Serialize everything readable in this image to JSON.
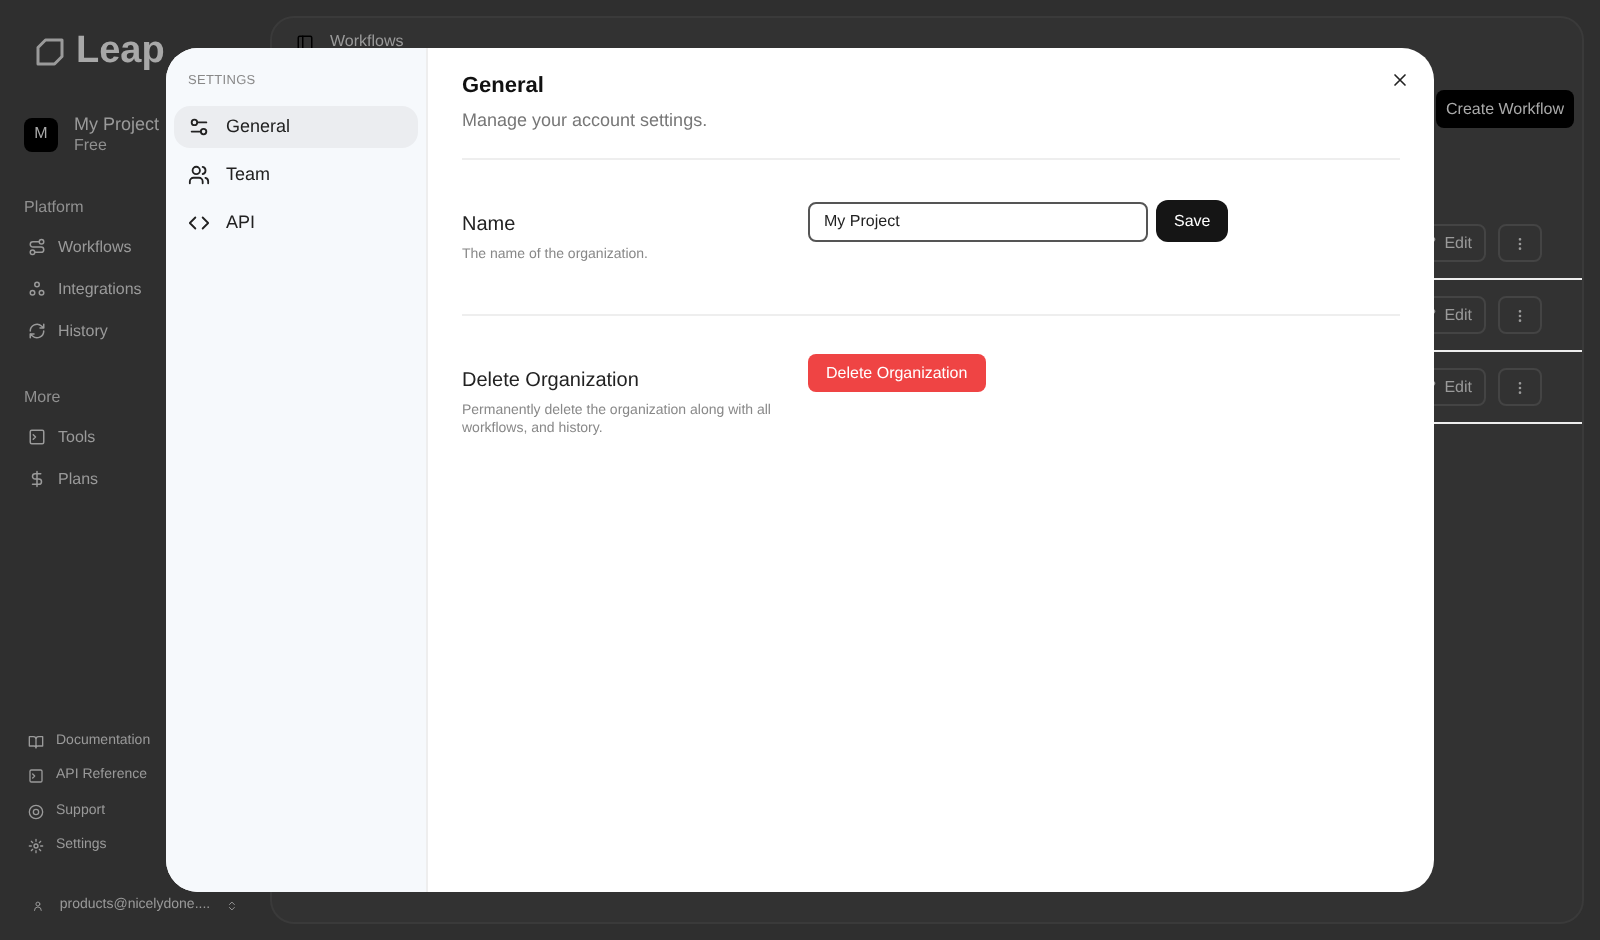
{
  "app": {
    "logo": "Leap",
    "project": {
      "initial": "M",
      "name": "My Project",
      "plan": "Free"
    },
    "sections": [
      {
        "heading": "Platform",
        "items": [
          "Workflows",
          "Integrations",
          "History"
        ]
      },
      {
        "heading": "More",
        "items": [
          "Tools",
          "Plans"
        ]
      }
    ],
    "footer_items": [
      "Documentation",
      "API Reference",
      "Support",
      "Settings"
    ],
    "user": "products@nicelydone....",
    "breadcrumb": "Workflows",
    "create_button": "Create Workflow",
    "rows": [
      {
        "edit": "Edit"
      },
      {
        "edit": "Edit"
      },
      {
        "edit": "Edit"
      }
    ]
  },
  "modal": {
    "nav_heading": "SETTINGS",
    "nav": [
      {
        "label": "General",
        "selected": true
      },
      {
        "label": "Team",
        "selected": false
      },
      {
        "label": "API",
        "selected": false
      }
    ],
    "title": "General",
    "subtitle": "Manage your account settings.",
    "sections": [
      {
        "kind": "field",
        "title": "Name",
        "description": "The name of the organization.",
        "value": "My Project",
        "button": "Save"
      },
      {
        "kind": "danger",
        "title": "Delete Organization",
        "description": "Permanently delete the organization along with all workflows, and history.",
        "button": "Delete Organization"
      }
    ]
  }
}
